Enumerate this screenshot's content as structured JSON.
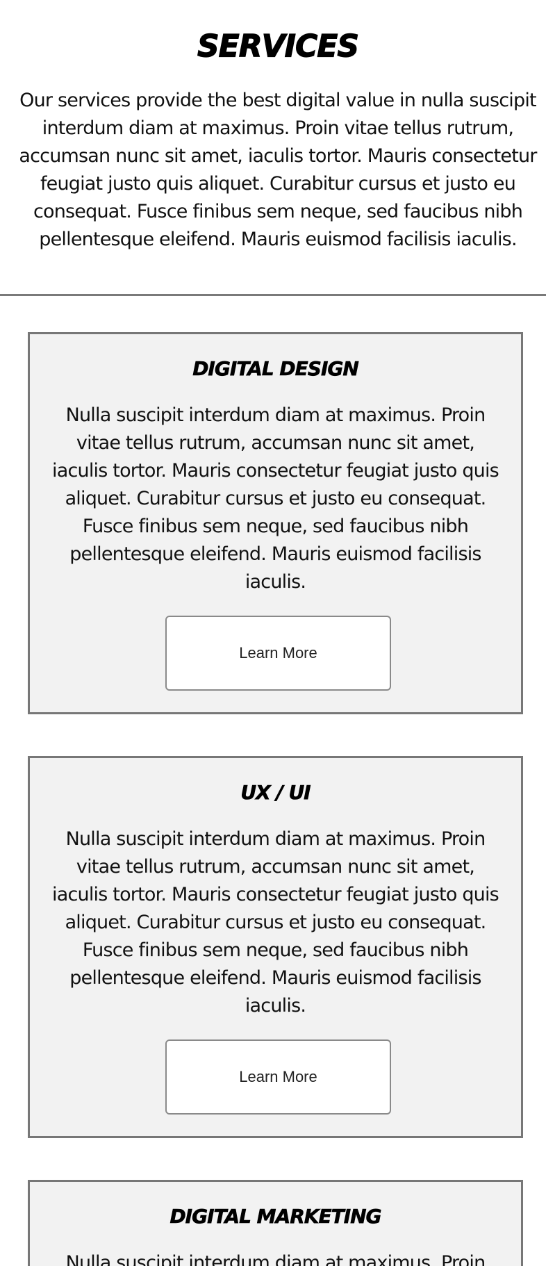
{
  "services": {
    "title": "SERVICES",
    "intro": "Our services provide the best digital value in nulla suscipit interdum diam at maximus. Proin vitae tellus rutrum, accumsan nunc sit amet, iaculis tortor. Mauris consectetur feugiat justo quis aliquet. Curabitur cursus et justo eu consequat. Fusce finibus sem neque, sed faucibus nibh pellentesque eleifend. Mauris euismod facilisis iaculis."
  },
  "cards": [
    {
      "title": "DIGITAL DESIGN",
      "body": "Nulla suscipit interdum diam at maximus. Proin vitae tellus rutrum, accumsan nunc sit amet, iaculis tortor. Mauris consectetur feugiat justo quis aliquet. Curabitur cursus et justo eu consequat. Fusce finibus sem neque, sed faucibus nibh pellentesque eleifend. Mauris euismod facilisis iaculis.",
      "button_label": "Learn More"
    },
    {
      "title": "UX / UI",
      "body": "Nulla suscipit interdum diam at maximus. Proin vitae tellus rutrum, accumsan nunc sit amet, iaculis tortor. Mauris consectetur feugiat justo quis aliquet. Curabitur cursus et justo eu consequat. Fusce finibus sem neque, sed faucibus nibh pellentesque eleifend. Mauris euismod facilisis iaculis.",
      "button_label": "Learn More"
    },
    {
      "title": "DIGITAL MARKETING",
      "body": "Nulla suscipit interdum diam at maximus. Proin"
    }
  ],
  "colors": {
    "card_background": "#f2f2f2",
    "card_border": "#777777",
    "divider": "#7a7a7a",
    "button_border": "#8a8a8a"
  }
}
